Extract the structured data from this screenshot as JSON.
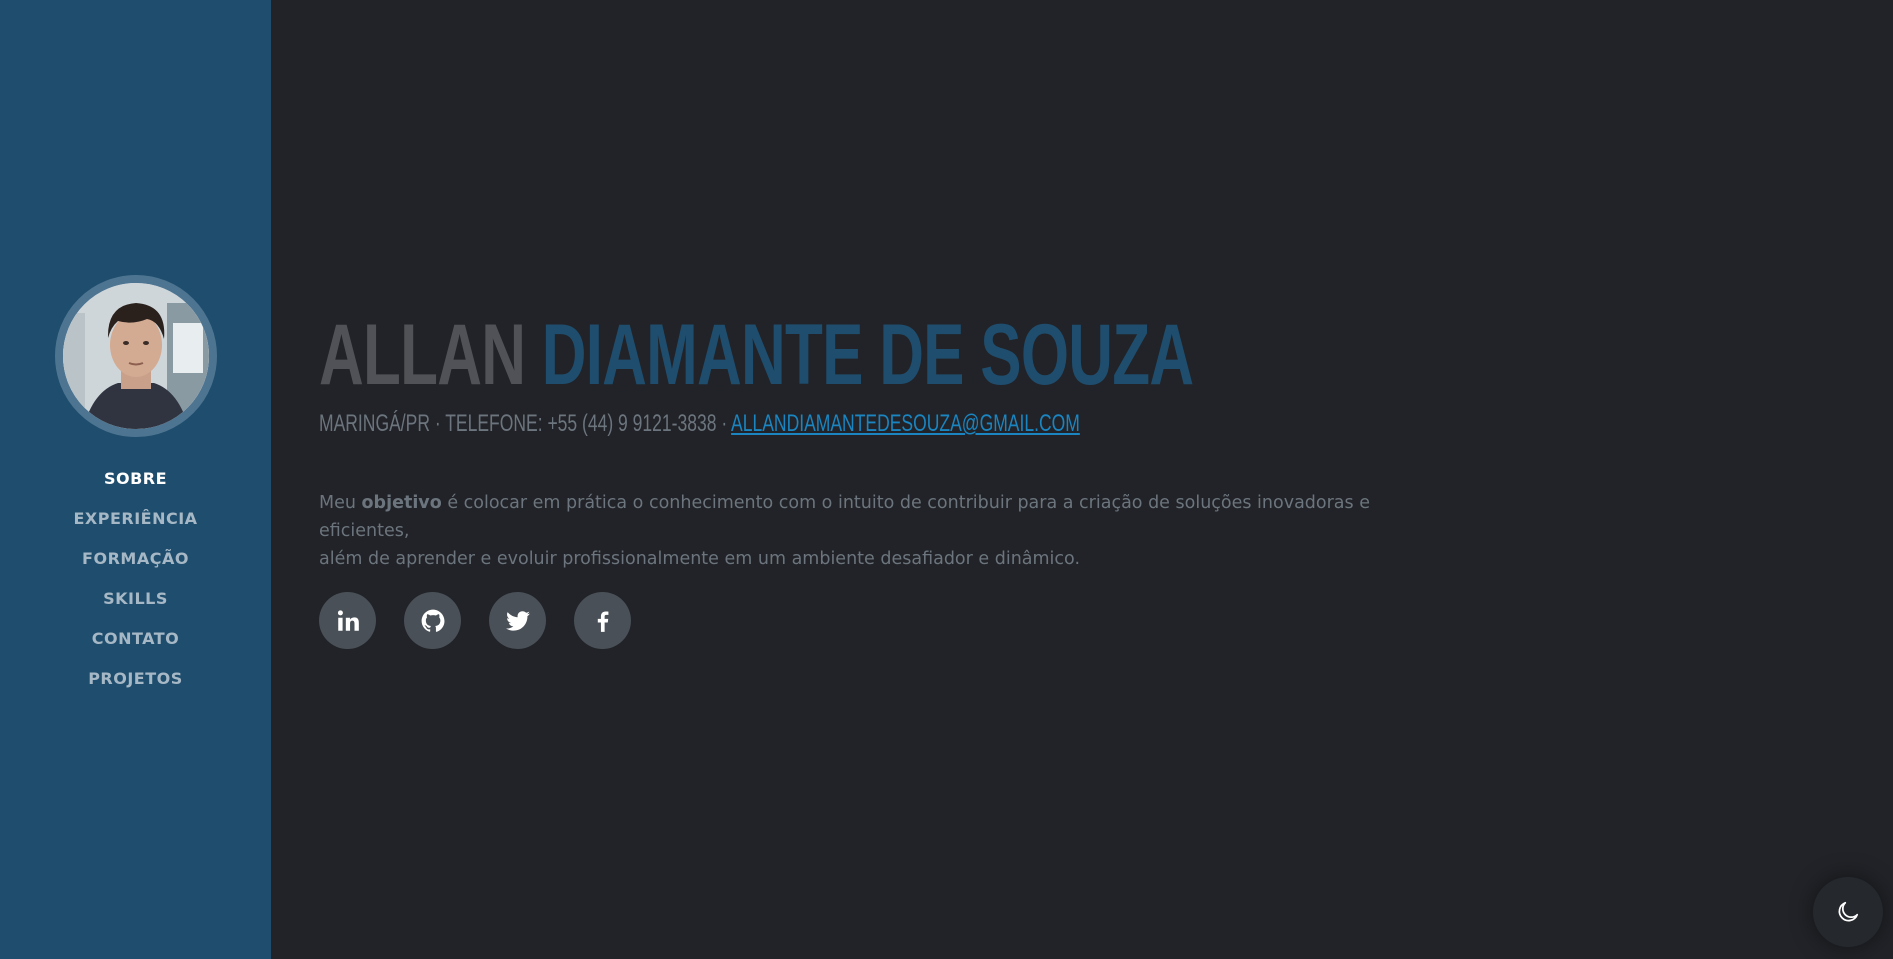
{
  "sidebar": {
    "avatar_alt": "profile photo",
    "nav": [
      {
        "label": "SOBRE",
        "active": true
      },
      {
        "label": "EXPERIÊNCIA"
      },
      {
        "label": "FORMAÇÃO"
      },
      {
        "label": "SKILLS"
      },
      {
        "label": "CONTATO"
      },
      {
        "label": "PROJETOS"
      }
    ]
  },
  "header": {
    "first_name": "ALLAN",
    "last_name": "DIAMANTE DE SOUZA",
    "location": "MARINGÁ/PR · TELEFONE: +55 (44) 9 9121-3838 · ",
    "email": "ALLANDIAMANTEDESOUZA@GMAIL.COM"
  },
  "lead": {
    "prefix": "Meu ",
    "bold": "objetivo",
    "line1_rest": " é colocar em prática o conhecimento com o intuito de contribuir para a criação de soluções inovadoras e eficientes,",
    "line2": "além de aprender e evoluir profissionalmente em um ambiente desafiador e dinâmico."
  },
  "social": [
    {
      "icon": "linkedin-icon"
    },
    {
      "icon": "github-icon"
    },
    {
      "icon": "twitter-icon"
    },
    {
      "icon": "facebook-icon"
    }
  ],
  "theme_toggle": {
    "icon": "moon-icon"
  },
  "colors": {
    "sidebar": "#1f4d6d",
    "background": "#212328",
    "accent": "#1f4d6d",
    "link": "#1a85c0"
  }
}
